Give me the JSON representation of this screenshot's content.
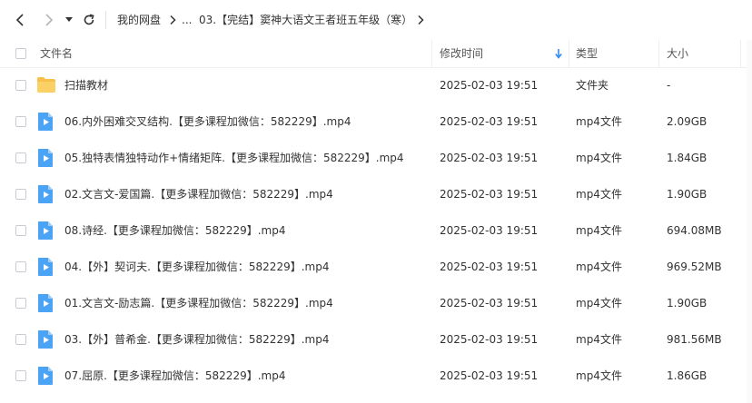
{
  "breadcrumb": {
    "items": [
      "我的网盘",
      "...",
      "03.【完结】窦神大语文王者班五年级（寒）"
    ]
  },
  "columns": {
    "name": "文件名",
    "modified": "修改时间",
    "type": "类型",
    "size": "大小"
  },
  "files": [
    {
      "name": "扫描教材",
      "modified": "2025-02-03 19:51",
      "type": "文件夹",
      "size": "-",
      "icon": "folder-icon"
    },
    {
      "name": "06.内外困难交叉结构.【更多课程加微信：582229】.mp4",
      "modified": "2025-02-03 19:51",
      "type": "mp4文件",
      "size": "2.09GB",
      "icon": "video-file-icon"
    },
    {
      "name": "05.独特表情独特动作+情绪矩阵.【更多课程加微信：582229】.mp4",
      "modified": "2025-02-03 19:51",
      "type": "mp4文件",
      "size": "1.84GB",
      "icon": "video-file-icon"
    },
    {
      "name": "02.文言文-爱国篇.【更多课程加微信：582229】.mp4",
      "modified": "2025-02-03 19:51",
      "type": "mp4文件",
      "size": "1.90GB",
      "icon": "video-file-icon"
    },
    {
      "name": "08.诗经.【更多课程加微信：582229】.mp4",
      "modified": "2025-02-03 19:51",
      "type": "mp4文件",
      "size": "694.08MB",
      "icon": "video-file-icon"
    },
    {
      "name": "04.【外】契诃夫.【更多课程加微信：582229】.mp4",
      "modified": "2025-02-03 19:51",
      "type": "mp4文件",
      "size": "969.52MB",
      "icon": "video-file-icon"
    },
    {
      "name": "01.文言文-励志篇.【更多课程加微信：582229】.mp4",
      "modified": "2025-02-03 19:51",
      "type": "mp4文件",
      "size": "1.90GB",
      "icon": "video-file-icon"
    },
    {
      "name": "03.【外】普希金.【更多课程加微信：582229】.mp4",
      "modified": "2025-02-03 19:51",
      "type": "mp4文件",
      "size": "981.56MB",
      "icon": "video-file-icon"
    },
    {
      "name": "07.屈原.【更多课程加微信：582229】.mp4",
      "modified": "2025-02-03 19:51",
      "type": "mp4文件",
      "size": "1.86GB",
      "icon": "video-file-icon"
    }
  ],
  "colors": {
    "accent": "#2f8cf2",
    "folder": "#f7c04a",
    "video": "#4aa3f5"
  }
}
